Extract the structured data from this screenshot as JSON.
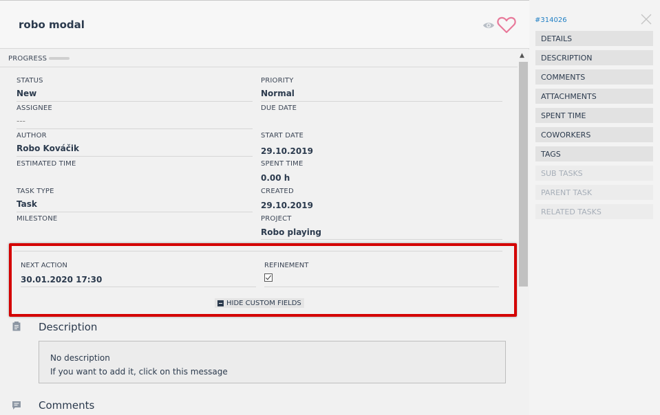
{
  "header": {
    "title": "robo modal"
  },
  "progress": {
    "label": "PROGRESS"
  },
  "fields": {
    "status": {
      "label": "STATUS",
      "value": "New"
    },
    "priority": {
      "label": "PRIORITY",
      "value": "Normal"
    },
    "assignee": {
      "label": "ASSIGNEE",
      "value": "---"
    },
    "due_date": {
      "label": "DUE DATE",
      "value": ""
    },
    "author": {
      "label": "AUTHOR",
      "value": "Robo Kováčik"
    },
    "start_date": {
      "label": "START DATE",
      "value": "29.10.2019"
    },
    "estimated_time": {
      "label": "ESTIMATED TIME",
      "value": ""
    },
    "spent_time": {
      "label": "SPENT TIME",
      "value": "0.00 h"
    },
    "task_type": {
      "label": "TASK TYPE",
      "value": "Task"
    },
    "created": {
      "label": "CREATED",
      "value": "29.10.2019"
    },
    "milestone": {
      "label": "MILESTONE",
      "value": ""
    },
    "project": {
      "label": "PROJECT",
      "value": "Robo playing"
    }
  },
  "custom_fields": {
    "next_action": {
      "label": "NEXT ACTION",
      "value": "30.01.2020 17:30"
    },
    "refinement": {
      "label": "REFINEMENT",
      "checked": true
    },
    "hide_button": "HIDE CUSTOM FIELDS"
  },
  "description": {
    "title": "Description",
    "empty_text": "No description",
    "hint": "If you want to add it, click on this message"
  },
  "comments": {
    "title": "Comments"
  },
  "sidebar": {
    "task_id": "#314026",
    "items": [
      {
        "label": "DETAILS",
        "enabled": true
      },
      {
        "label": "DESCRIPTION",
        "enabled": true
      },
      {
        "label": "COMMENTS",
        "enabled": true
      },
      {
        "label": "ATTACHMENTS",
        "enabled": true
      },
      {
        "label": "SPENT TIME",
        "enabled": true
      },
      {
        "label": "COWORKERS",
        "enabled": true
      },
      {
        "label": "TAGS",
        "enabled": true
      },
      {
        "label": "SUB TASKS",
        "enabled": false
      },
      {
        "label": "PARENT TASK",
        "enabled": false
      },
      {
        "label": "RELATED TASKS",
        "enabled": false
      }
    ]
  },
  "colors": {
    "highlight": "#d40000",
    "heart": "#e8799a",
    "link": "#1f7fc4"
  }
}
